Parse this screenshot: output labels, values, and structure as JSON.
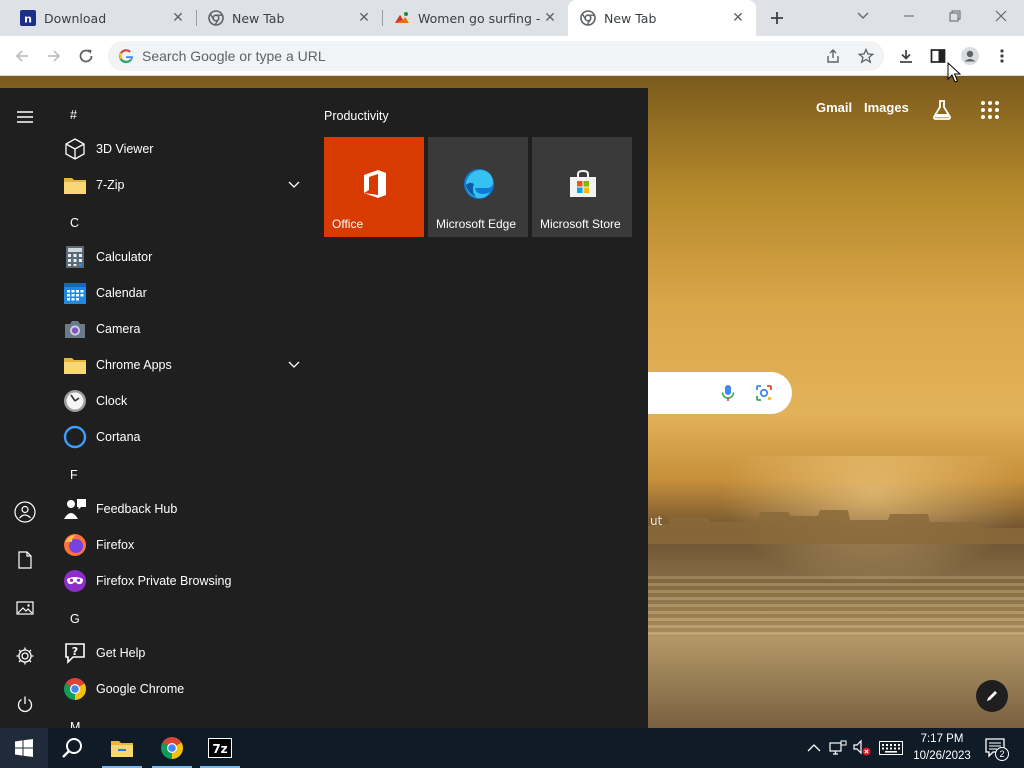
{
  "browser": {
    "tabs": [
      {
        "title": "Download",
        "favicon": "n-brand-icon",
        "active": false
      },
      {
        "title": "New Tab",
        "favicon": "chrome-icon",
        "active": false
      },
      {
        "title": "Women go surfing - Cl",
        "favicon": "image-gallery-icon",
        "active": false
      },
      {
        "title": "New Tab",
        "favicon": "chrome-icon",
        "active": true
      }
    ],
    "omnibox_placeholder": "Search Google or type a URL"
  },
  "ntp": {
    "gmail_label": "Gmail",
    "images_label": "Images",
    "shortcut_fragment": "ut"
  },
  "start_menu": {
    "rows": [
      {
        "kind": "header",
        "text": "#"
      },
      {
        "kind": "app",
        "text": "3D Viewer",
        "icon": "cube-icon"
      },
      {
        "kind": "app",
        "text": "7-Zip",
        "icon": "folder-icon",
        "expandable": true
      },
      {
        "kind": "header",
        "text": "C"
      },
      {
        "kind": "app",
        "text": "Calculator",
        "icon": "calculator-icon"
      },
      {
        "kind": "app",
        "text": "Calendar",
        "icon": "calendar-icon"
      },
      {
        "kind": "app",
        "text": "Camera",
        "icon": "camera-icon"
      },
      {
        "kind": "app",
        "text": "Chrome Apps",
        "icon": "folder-icon",
        "expandable": true
      },
      {
        "kind": "app",
        "text": "Clock",
        "icon": "clock-icon"
      },
      {
        "kind": "app",
        "text": "Cortana",
        "icon": "cortana-icon"
      },
      {
        "kind": "header",
        "text": "F"
      },
      {
        "kind": "app",
        "text": "Feedback Hub",
        "icon": "feedback-icon"
      },
      {
        "kind": "app",
        "text": "Firefox",
        "icon": "firefox-icon"
      },
      {
        "kind": "app",
        "text": "Firefox Private Browsing",
        "icon": "private-browsing-icon"
      },
      {
        "kind": "header",
        "text": "G"
      },
      {
        "kind": "app",
        "text": "Get Help",
        "icon": "help-icon"
      },
      {
        "kind": "app",
        "text": "Google Chrome",
        "icon": "chrome-icon"
      },
      {
        "kind": "header",
        "text": "M"
      }
    ],
    "tiles_group_title": "Productivity",
    "tiles": [
      {
        "label": "Office",
        "icon": "office-icon",
        "color": "#d83b01"
      },
      {
        "label": "Microsoft Edge",
        "icon": "edge-icon",
        "color": "#3a3a3a"
      },
      {
        "label": "Microsoft Store",
        "icon": "store-icon",
        "color": "#3a3a3a"
      }
    ]
  },
  "taskbar": {
    "time": "7:17 PM",
    "date": "10/26/2023",
    "notifications_count": "2"
  },
  "colors": {
    "start_bg": "#1f1f1f",
    "taskbar_bg": "#101b28",
    "office_tile": "#d83b01",
    "tile_bg": "#3a3a3a"
  }
}
